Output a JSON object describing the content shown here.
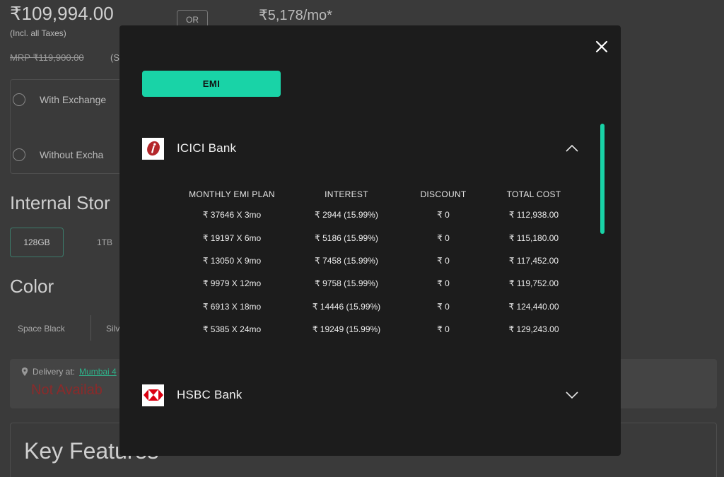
{
  "background": {
    "price": "₹109,994.00",
    "price_note": "(Incl. all Taxes)",
    "or_label": "OR",
    "emi_price": "₹5,178/mo*",
    "mrp": "MRP ₹119,900.00",
    "mrp_extra": "(S",
    "exchange_options": [
      "With Exchange",
      "Without Excha"
    ],
    "internal_storage_title": "Internal Stor",
    "storage_options": [
      "128GB",
      "1TB"
    ],
    "color_title": "Color",
    "color_options": [
      "Space Black",
      "Silv"
    ],
    "delivery_label": "Delivery at:",
    "delivery_city": "Mumbai 4",
    "not_available": "Not Availab",
    "key_features_title": "Key Features"
  },
  "modal": {
    "tab_label": "EMI",
    "banks": [
      {
        "name": "ICICI Bank",
        "expanded": true,
        "headers": [
          "MONTHLY EMI PLAN",
          "INTEREST",
          "DISCOUNT",
          "TOTAL COST"
        ],
        "plans": [
          {
            "plan": "₹ 37646  X 3mo",
            "interest": "₹ 2944 (15.99%)",
            "discount": "₹ 0",
            "total": "₹ 112,938.00"
          },
          {
            "plan": "₹ 19197  X 6mo",
            "interest": "₹ 5186 (15.99%)",
            "discount": "₹ 0",
            "total": "₹ 115,180.00"
          },
          {
            "plan": "₹ 13050  X 9mo",
            "interest": "₹ 7458 (15.99%)",
            "discount": "₹ 0",
            "total": "₹ 117,452.00"
          },
          {
            "plan": "₹ 9979  X 12mo",
            "interest": "₹ 9758 (15.99%)",
            "discount": "₹ 0",
            "total": "₹ 119,752.00"
          },
          {
            "plan": "₹ 6913  X 18mo",
            "interest": "₹ 14446 (15.99%)",
            "discount": "₹ 0",
            "total": "₹ 124,440.00"
          },
          {
            "plan": "₹ 5385  X 24mo",
            "interest": "₹ 19249 (15.99%)",
            "discount": "₹ 0",
            "total": "₹ 129,243.00"
          }
        ]
      },
      {
        "name": "HSBC Bank",
        "expanded": false
      }
    ]
  },
  "colors": {
    "accent": "#19d3a7",
    "modal_bg": "#1c1c1c",
    "icici_red": "#b4262a",
    "hsbc_red": "#db0011"
  },
  "icons": {
    "close": "close-icon",
    "collapse": "chevron-up-icon",
    "expand": "chevron-down-icon",
    "location": "location-pin-icon"
  }
}
